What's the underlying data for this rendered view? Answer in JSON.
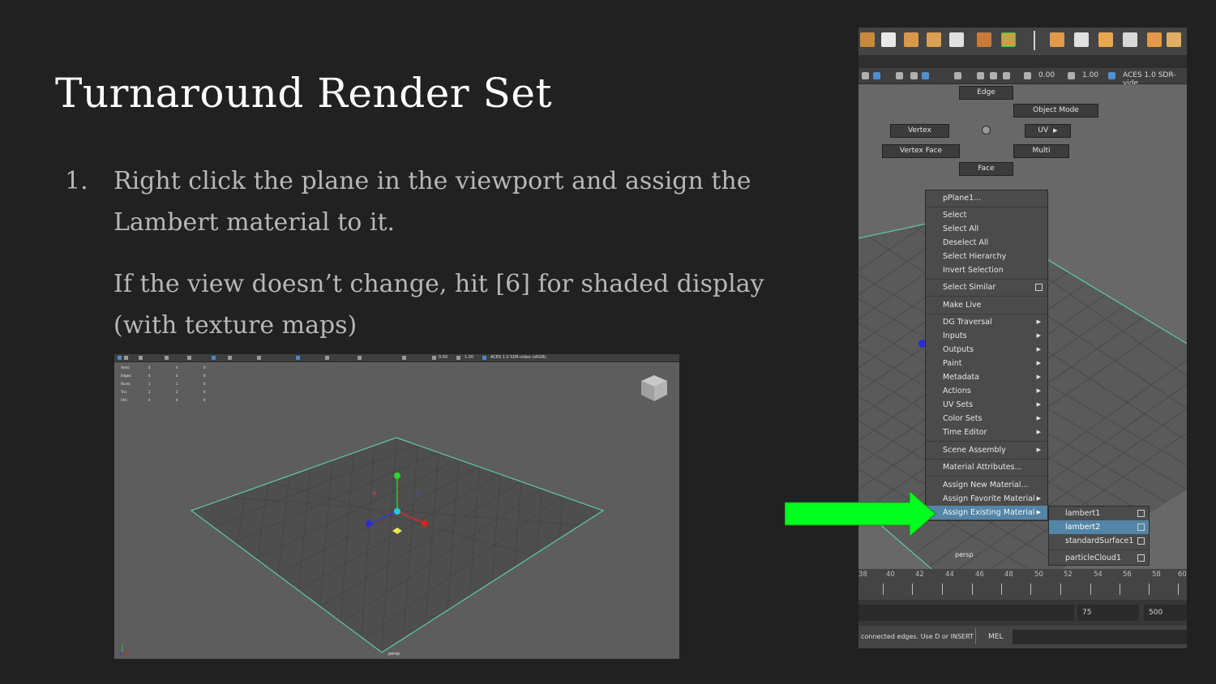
{
  "slide": {
    "title": "Turnaround Render Set",
    "step_number": "1.",
    "step_text": "Right click the plane in the viewport and assign the Lambert material to it.",
    "note_text": "If the view doesn’t change, hit [6] for shaded display (with texture maps)"
  },
  "left_viewport": {
    "panel_values": [
      "0.00",
      "1.00"
    ],
    "color_space": "ACES 1.0 SDR-video (sRGB)",
    "hud": {
      "rows": [
        {
          "label": "Verts:",
          "a": "4",
          "b": "4",
          "c": "0"
        },
        {
          "label": "Edges:",
          "a": "4",
          "b": "4",
          "c": "0"
        },
        {
          "label": "Faces:",
          "a": "1",
          "b": "1",
          "c": "0"
        },
        {
          "label": "Tris:",
          "a": "2",
          "b": "2",
          "c": "0"
        },
        {
          "label": "UVs:",
          "a": "4",
          "b": "4",
          "c": "0"
        }
      ]
    },
    "camera_label": "persp"
  },
  "maya_viewport": {
    "panel_values": [
      "0.00",
      "1.00"
    ],
    "color_space": "ACES 1.0 SDR-vide",
    "marking_menu": {
      "edge": "Edge",
      "object_mode": "Object Mode",
      "vertex": "Vertex",
      "uv": "UV",
      "vertex_face": "Vertex Face",
      "multi": "Multi",
      "face": "Face"
    },
    "context_menu": {
      "header": "pPlane1...",
      "items": [
        "Select",
        "Select All",
        "Deselect All",
        "Select Hierarchy",
        "Invert Selection",
        "Select Similar",
        "Make Live",
        "DG Traversal",
        "Inputs",
        "Outputs",
        "Paint",
        "Metadata",
        "Actions",
        "UV Sets",
        "Color Sets",
        "Time Editor",
        "Scene Assembly",
        "Material Attributes...",
        "Assign New Material...",
        "Assign Favorite Material",
        "Assign Existing Material"
      ],
      "highlighted": "Assign Existing Material"
    },
    "submenu": {
      "items": [
        "lambert1",
        "lambert2",
        "standardSurface1",
        "particleCloud1"
      ],
      "highlighted": "lambert2"
    },
    "camera_label": "persp",
    "timeline_ticks": [
      "38",
      "40",
      "42",
      "44",
      "46",
      "48",
      "50",
      "52",
      "54",
      "56",
      "58",
      "60"
    ],
    "range_fields": [
      "75",
      "500"
    ],
    "status_message": "connected edges. Use D or INSERT",
    "script_type": "MEL"
  },
  "colors": {
    "background": "#212121",
    "title": "#ffffff",
    "body_text": "#b7b7b7",
    "highlight": "#5285a6",
    "arrow": "#00ff1e",
    "grid_edge": "#5fc9a0"
  }
}
